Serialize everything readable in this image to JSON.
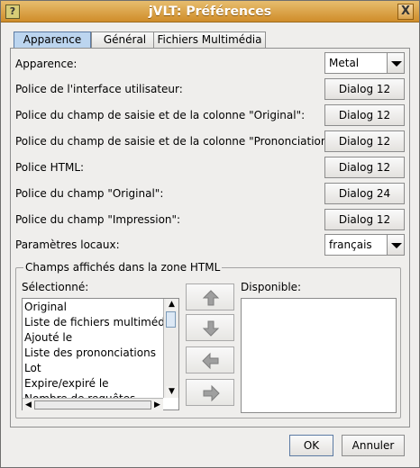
{
  "window": {
    "title": "jVLT: Préférences",
    "app_icon_label": "?",
    "close_label": "X"
  },
  "tabs": [
    {
      "label": "Apparence",
      "active": true
    },
    {
      "label": "Général",
      "active": false
    },
    {
      "label": "Fichiers Multimédia",
      "active": false
    }
  ],
  "settings": {
    "appearance_label": "Apparence:",
    "appearance_value": "Metal",
    "ui_font_label": "Police de l'interface utilisateur:",
    "ui_font_value": "Dialog 12",
    "original_input_font_label": "Police du champ de saisie et de la colonne \"Original\":",
    "original_input_font_value": "Dialog 12",
    "pronunciation_font_label": "Police du champ de saisie et de la colonne \"Prononciation\":",
    "pronunciation_font_value": "Dialog 12",
    "html_font_label": "Police HTML:",
    "html_font_value": "Dialog 12",
    "original_field_font_label": "Police du champ \"Original\":",
    "original_field_font_value": "Dialog 24",
    "print_field_font_label": "Police du champ \"Impression\":",
    "print_field_font_value": "Dialog 12",
    "locale_label": "Paramètres locaux:",
    "locale_value": "français"
  },
  "html_fields": {
    "group_title": "Champs affichés dans la zone HTML",
    "selected_label": "Sélectionné:",
    "available_label": "Disponible:",
    "selected_items": [
      "Original",
      "Liste de fichiers multimédia",
      "Ajouté le",
      "Liste des prononciations",
      "Lot",
      "Expire/expiré le",
      "Nombre de requêtes"
    ],
    "available_items": []
  },
  "buttons": {
    "ok": "OK",
    "cancel": "Annuler"
  },
  "icons": {
    "move_up": "arrow-up-icon",
    "move_down": "arrow-down-icon",
    "move_left": "arrow-left-icon",
    "move_right": "arrow-right-icon"
  }
}
